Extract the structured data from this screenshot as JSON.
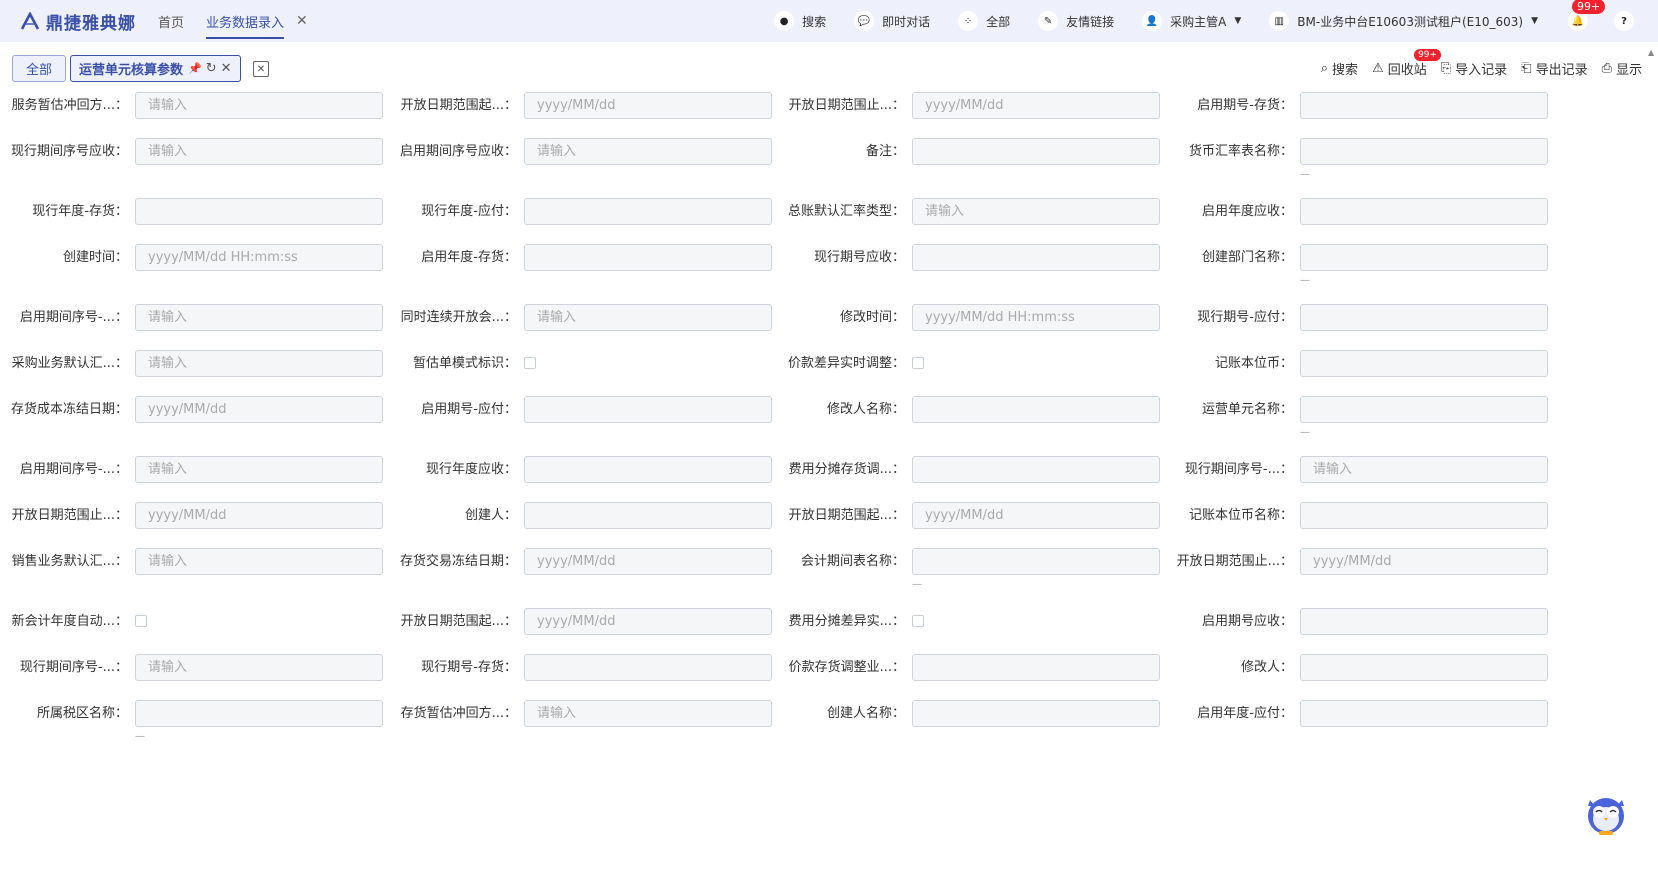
{
  "topbar": {
    "logo_text": "鼎捷雅典娜",
    "nav_home": "首页",
    "nav_active": "业务数据录入",
    "nav_close": "✕",
    "tools": [
      {
        "icon": "search-icon",
        "label": "搜索"
      },
      {
        "icon": "chat-icon",
        "label": "即时对话"
      },
      {
        "icon": "grid-icon",
        "label": "全部"
      },
      {
        "icon": "link-icon",
        "label": "友情链接"
      },
      {
        "icon": "user-icon",
        "label": "采购主管A"
      },
      {
        "icon": "building-icon",
        "label": "BM-业务中台E10603测试租户(E10_603)"
      }
    ],
    "bell_badge": "99+",
    "help": "?"
  },
  "tabs": {
    "all": "全部",
    "active": "运营单元核算参数"
  },
  "actions": [
    {
      "icon": "search-icon",
      "label": "搜索"
    },
    {
      "icon": "recycle-icon",
      "label": "回收站",
      "badge": "99+"
    },
    {
      "icon": "import-icon",
      "label": "导入记录"
    },
    {
      "icon": "export-icon",
      "label": "导出记录"
    },
    {
      "icon": "display-icon",
      "label": "显示"
    }
  ],
  "form_rows": [
    [
      {
        "label": "服务暂估冲回方...：",
        "type": "input",
        "placeholder": "请输入"
      },
      {
        "label": "开放日期范围起...：",
        "type": "input",
        "placeholder": "yyyy/MM/dd"
      },
      {
        "label": "开放日期范围止...：",
        "type": "input",
        "placeholder": "yyyy/MM/dd"
      },
      {
        "label": "启用期号-存货：",
        "type": "input",
        "placeholder": ""
      }
    ],
    [
      {
        "label": "现行期间序号应收：",
        "type": "input",
        "placeholder": "请输入"
      },
      {
        "label": "启用期间序号应收：",
        "type": "input",
        "placeholder": "请输入"
      },
      {
        "label": "备注：",
        "type": "input",
        "placeholder": ""
      },
      {
        "label": "货币汇率表名称：",
        "type": "input",
        "placeholder": "",
        "dash": "—"
      }
    ],
    [
      {
        "label": "现行年度-存货：",
        "type": "input",
        "placeholder": ""
      },
      {
        "label": "现行年度-应付：",
        "type": "input",
        "placeholder": ""
      },
      {
        "label": "总账默认汇率类型：",
        "type": "input",
        "placeholder": "请输入"
      },
      {
        "label": "启用年度应收：",
        "type": "input",
        "placeholder": ""
      }
    ],
    [
      {
        "label": "创建时间：",
        "type": "input",
        "placeholder": "yyyy/MM/dd HH:mm:ss"
      },
      {
        "label": "启用年度-存货：",
        "type": "input",
        "placeholder": ""
      },
      {
        "label": "现行期号应收：",
        "type": "input",
        "placeholder": ""
      },
      {
        "label": "创建部门名称：",
        "type": "input",
        "placeholder": "",
        "dash": "—"
      }
    ],
    [
      {
        "label": "启用期间序号-...：",
        "type": "input",
        "placeholder": "请输入"
      },
      {
        "label": "同时连续开放会...：",
        "type": "input",
        "placeholder": "请输入"
      },
      {
        "label": "修改时间：",
        "type": "input",
        "placeholder": "yyyy/MM/dd HH:mm:ss"
      },
      {
        "label": "现行期号-应付：",
        "type": "input",
        "placeholder": ""
      }
    ],
    [
      {
        "label": "采购业务默认汇...：",
        "type": "input",
        "placeholder": "请输入"
      },
      {
        "label": "暂估单模式标识：",
        "type": "checkbox"
      },
      {
        "label": "价款差异实时调整：",
        "type": "checkbox"
      },
      {
        "label": "记账本位币：",
        "type": "input",
        "placeholder": ""
      }
    ],
    [
      {
        "label": "存货成本冻结日期：",
        "type": "input",
        "placeholder": "yyyy/MM/dd"
      },
      {
        "label": "启用期号-应付：",
        "type": "input",
        "placeholder": ""
      },
      {
        "label": "修改人名称：",
        "type": "input",
        "placeholder": ""
      },
      {
        "label": "运营单元名称：",
        "type": "input",
        "placeholder": "",
        "dash": "—"
      }
    ],
    [
      {
        "label": "启用期间序号-...：",
        "type": "input",
        "placeholder": "请输入"
      },
      {
        "label": "现行年度应收：",
        "type": "input",
        "placeholder": ""
      },
      {
        "label": "费用分摊存货调...：",
        "type": "input",
        "placeholder": ""
      },
      {
        "label": "现行期间序号-...：",
        "type": "input",
        "placeholder": "请输入"
      }
    ],
    [
      {
        "label": "开放日期范围止...：",
        "type": "input",
        "placeholder": "yyyy/MM/dd"
      },
      {
        "label": "创建人：",
        "type": "input",
        "placeholder": ""
      },
      {
        "label": "开放日期范围起...：",
        "type": "input",
        "placeholder": "yyyy/MM/dd"
      },
      {
        "label": "记账本位币名称：",
        "type": "input",
        "placeholder": ""
      }
    ],
    [
      {
        "label": "销售业务默认汇...：",
        "type": "input",
        "placeholder": "请输入"
      },
      {
        "label": "存货交易冻结日期：",
        "type": "input",
        "placeholder": "yyyy/MM/dd"
      },
      {
        "label": "会计期间表名称：",
        "type": "input",
        "placeholder": "",
        "dash": "—"
      },
      {
        "label": "开放日期范围止...：",
        "type": "input",
        "placeholder": "yyyy/MM/dd"
      }
    ],
    [
      {
        "label": "新会计年度自动...：",
        "type": "checkbox"
      },
      {
        "label": "开放日期范围起...：",
        "type": "input",
        "placeholder": "yyyy/MM/dd"
      },
      {
        "label": "费用分摊差异实...：",
        "type": "checkbox"
      },
      {
        "label": "启用期号应收：",
        "type": "input",
        "placeholder": ""
      }
    ],
    [
      {
        "label": "现行期间序号-...：",
        "type": "input",
        "placeholder": "请输入"
      },
      {
        "label": "现行期号-存货：",
        "type": "input",
        "placeholder": ""
      },
      {
        "label": "价款存货调整业...：",
        "type": "input",
        "placeholder": ""
      },
      {
        "label": "修改人：",
        "type": "input",
        "placeholder": ""
      }
    ],
    [
      {
        "label": "所属税区名称：",
        "type": "input",
        "placeholder": "",
        "dash": "—"
      },
      {
        "label": "存货暂估冲回方...：",
        "type": "input",
        "placeholder": "请输入"
      },
      {
        "label": "创建人名称：",
        "type": "input",
        "placeholder": ""
      },
      {
        "label": "启用年度-应付：",
        "type": "input",
        "placeholder": ""
      }
    ]
  ]
}
